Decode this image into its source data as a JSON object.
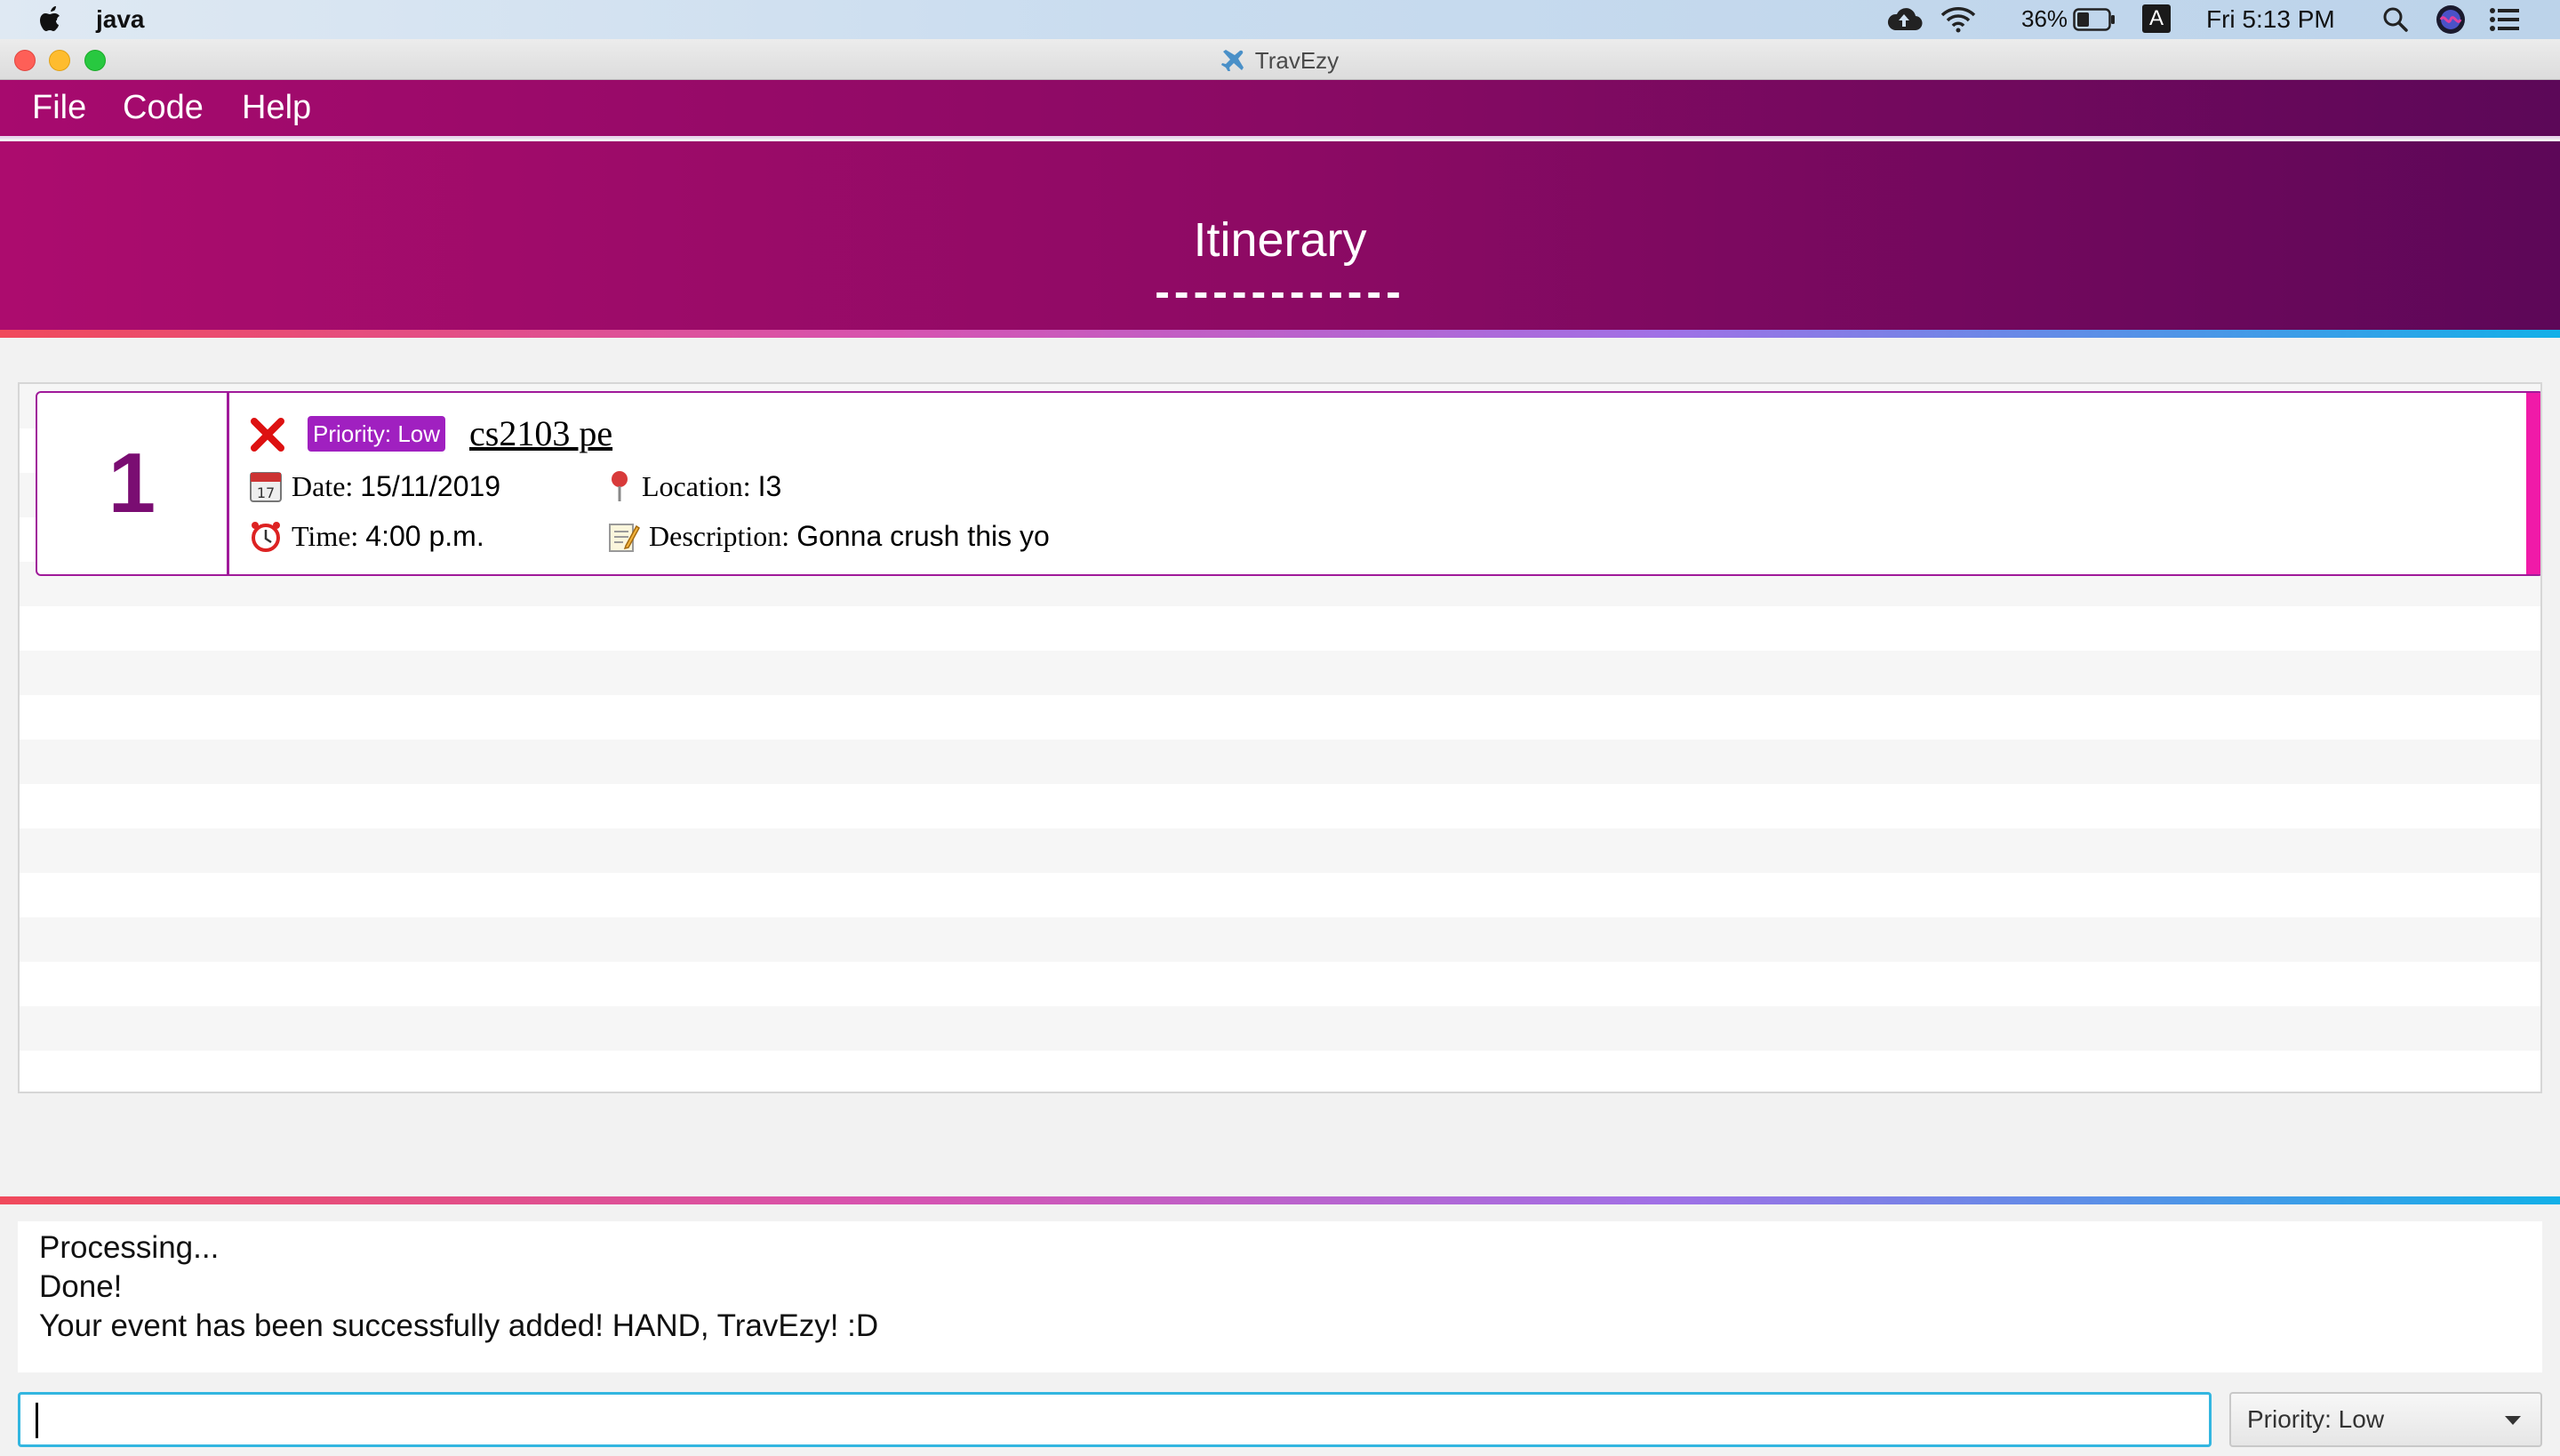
{
  "mac_menubar": {
    "app_name": "java",
    "battery_percent": "36%",
    "input_source": "A",
    "clock": "Fri 5:13 PM",
    "icons": [
      "apple-icon",
      "cloud-upload-icon",
      "wifi-icon",
      "battery-icon",
      "spotlight-icon",
      "siri-icon",
      "list-icon"
    ]
  },
  "window": {
    "title": "TravEzy",
    "title_icon": "airplane-icon"
  },
  "menu": {
    "file": "File",
    "code": "Code",
    "help": "Help"
  },
  "header": {
    "title": "Itinerary",
    "underline": "-------------"
  },
  "events": [
    {
      "index": "1",
      "priority_badge": "Priority: Low",
      "name": "cs2103 pe",
      "date_label": "Date:",
      "date_value": "15/11/2019",
      "time_label": "Time:",
      "time_value": "4:00 p.m.",
      "location_label": "Location:",
      "location_value": "I3",
      "description_label": "Description:",
      "description_value": "Gonna crush this yo"
    }
  ],
  "result": {
    "lines": [
      "Processing...",
      "Done!",
      "Your event has been successfully added! HAND, TravEzy! :D"
    ]
  },
  "command": {
    "value": "",
    "priority_selected": "Priority: Low"
  },
  "colors": {
    "header_start": "#ac0c6e",
    "header_end": "#5d0758",
    "card_border": "#a01a9a",
    "card_accent": "#f01aa8",
    "priority_badge": "#a020c0",
    "command_border": "#33b6e0"
  }
}
